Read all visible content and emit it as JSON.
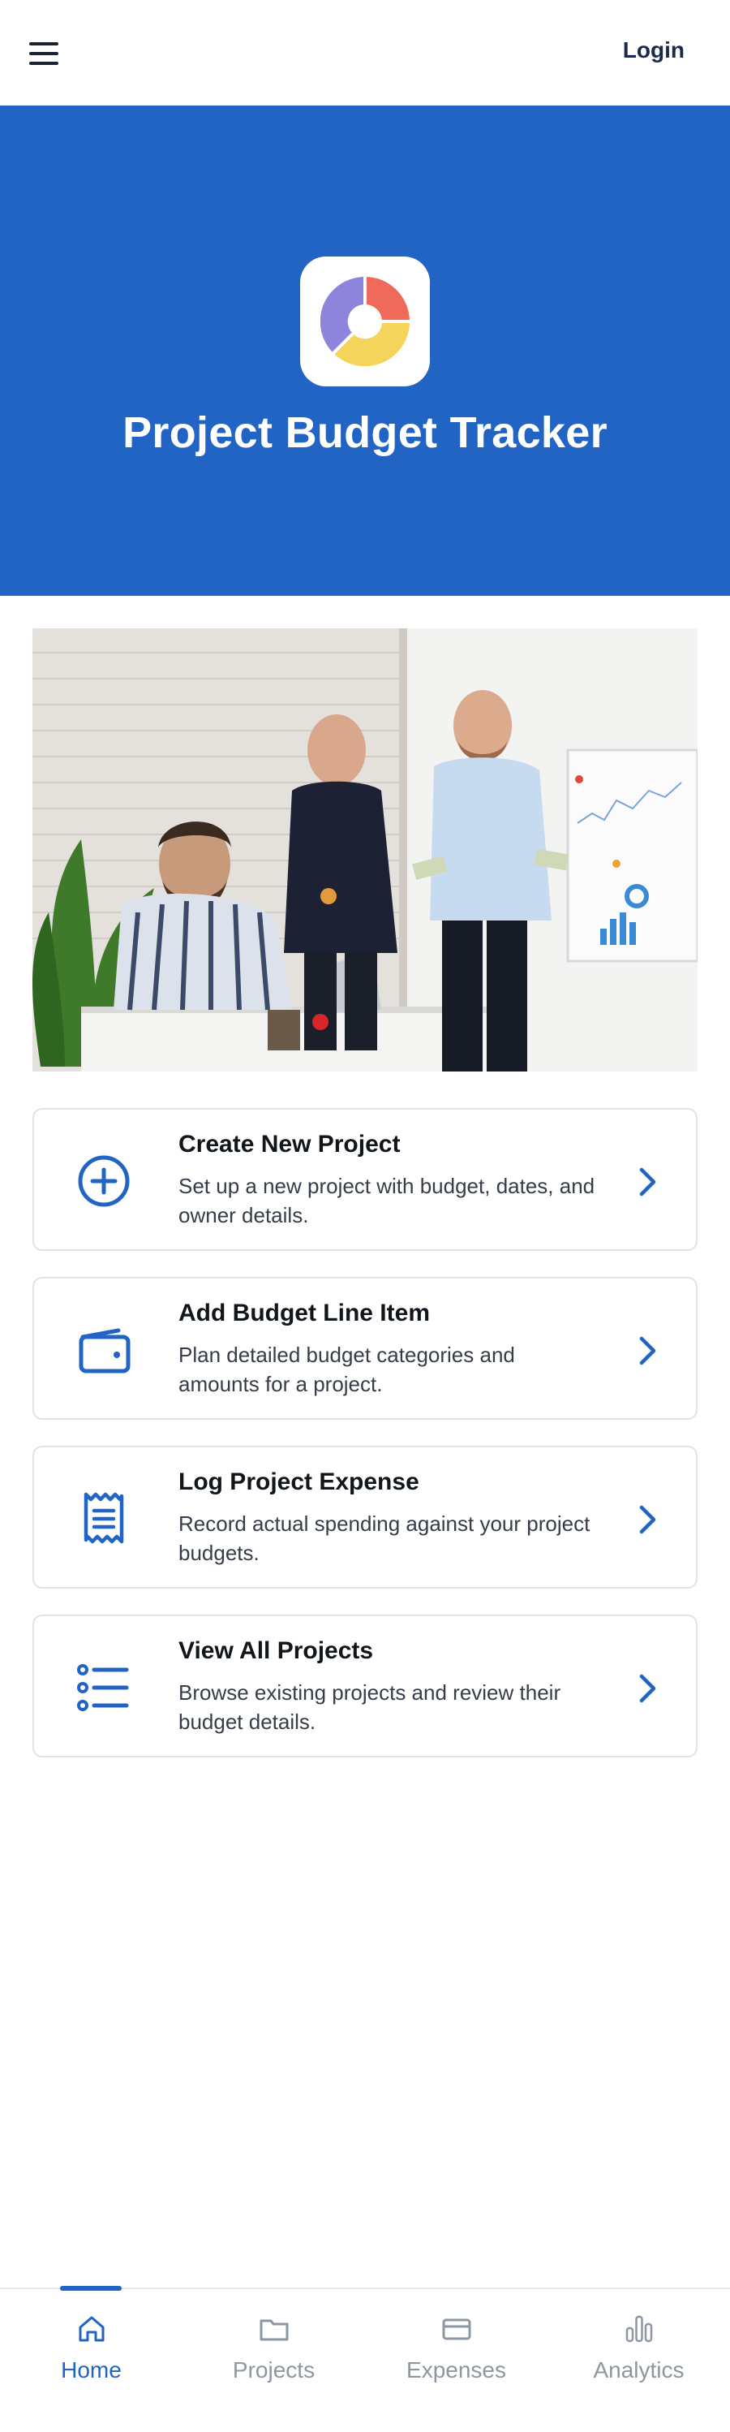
{
  "header": {
    "login_label": "Login"
  },
  "hero": {
    "title": "Project Budget Tracker"
  },
  "actions": [
    {
      "title": "Create New Project",
      "description": "Set up a new project with budget, dates, and owner details.",
      "icon": "plus-circle-icon"
    },
    {
      "title": "Add Budget Line Item",
      "description": "Plan detailed budget categories and amounts for a project.",
      "icon": "wallet-icon"
    },
    {
      "title": "Log Project Expense",
      "description": "Record actual spending against your project budgets.",
      "icon": "receipt-icon"
    },
    {
      "title": "View All Projects",
      "description": "Browse existing projects and review their budget details.",
      "icon": "list-icon"
    }
  ],
  "nav": {
    "items": [
      {
        "label": "Home",
        "icon": "home-icon",
        "active": true
      },
      {
        "label": "Projects",
        "icon": "folder-icon",
        "active": false
      },
      {
        "label": "Expenses",
        "icon": "card-icon",
        "active": false
      },
      {
        "label": "Analytics",
        "icon": "bar-chart-icon",
        "active": false
      }
    ]
  },
  "colors": {
    "primary": "#2264c4",
    "logo_red": "#ef6a5a",
    "logo_yellow": "#f5d45c",
    "logo_purple": "#8d84dc",
    "inactive_nav": "#8e96a3"
  }
}
